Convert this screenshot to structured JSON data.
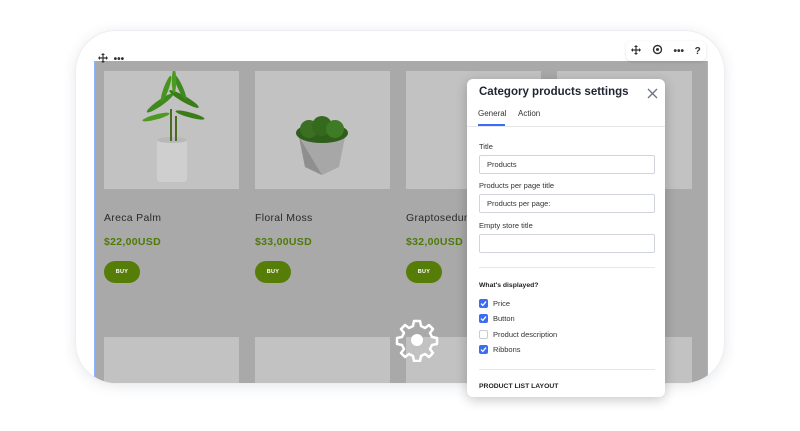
{
  "products": [
    {
      "name": "Areca Palm",
      "price": "$22,00USD",
      "button": "BUY"
    },
    {
      "name": "Floral Moss",
      "price": "$33,00USD",
      "button": "BUY"
    },
    {
      "name": "Graptosedum",
      "price": "$32,00USD",
      "button": "BUY"
    }
  ],
  "toolbar": {
    "move_icon": "move-icon",
    "more_icon": "more-icon",
    "settings_icon": "gear-icon",
    "help_label": "?"
  },
  "panel": {
    "title": "Category products settings",
    "tabs": [
      {
        "label": "General",
        "active": true
      },
      {
        "label": "Action",
        "active": false
      }
    ],
    "fields": {
      "title_label": "Title",
      "title_value": "Products",
      "per_page_label": "Products per page title",
      "per_page_value": "Products per page:",
      "empty_label": "Empty store title",
      "empty_value": ""
    },
    "displayed_label": "What's displayed?",
    "checkboxes": [
      {
        "label": "Price",
        "checked": true
      },
      {
        "label": "Button",
        "checked": true
      },
      {
        "label": "Product description",
        "checked": false
      },
      {
        "label": "Ribbons",
        "checked": true
      }
    ],
    "layout_label": "PRODUCT LIST LAYOUT"
  },
  "colors": {
    "accent": "#3b6df0",
    "price": "#4e7a06",
    "buy_button": "#577d09"
  }
}
